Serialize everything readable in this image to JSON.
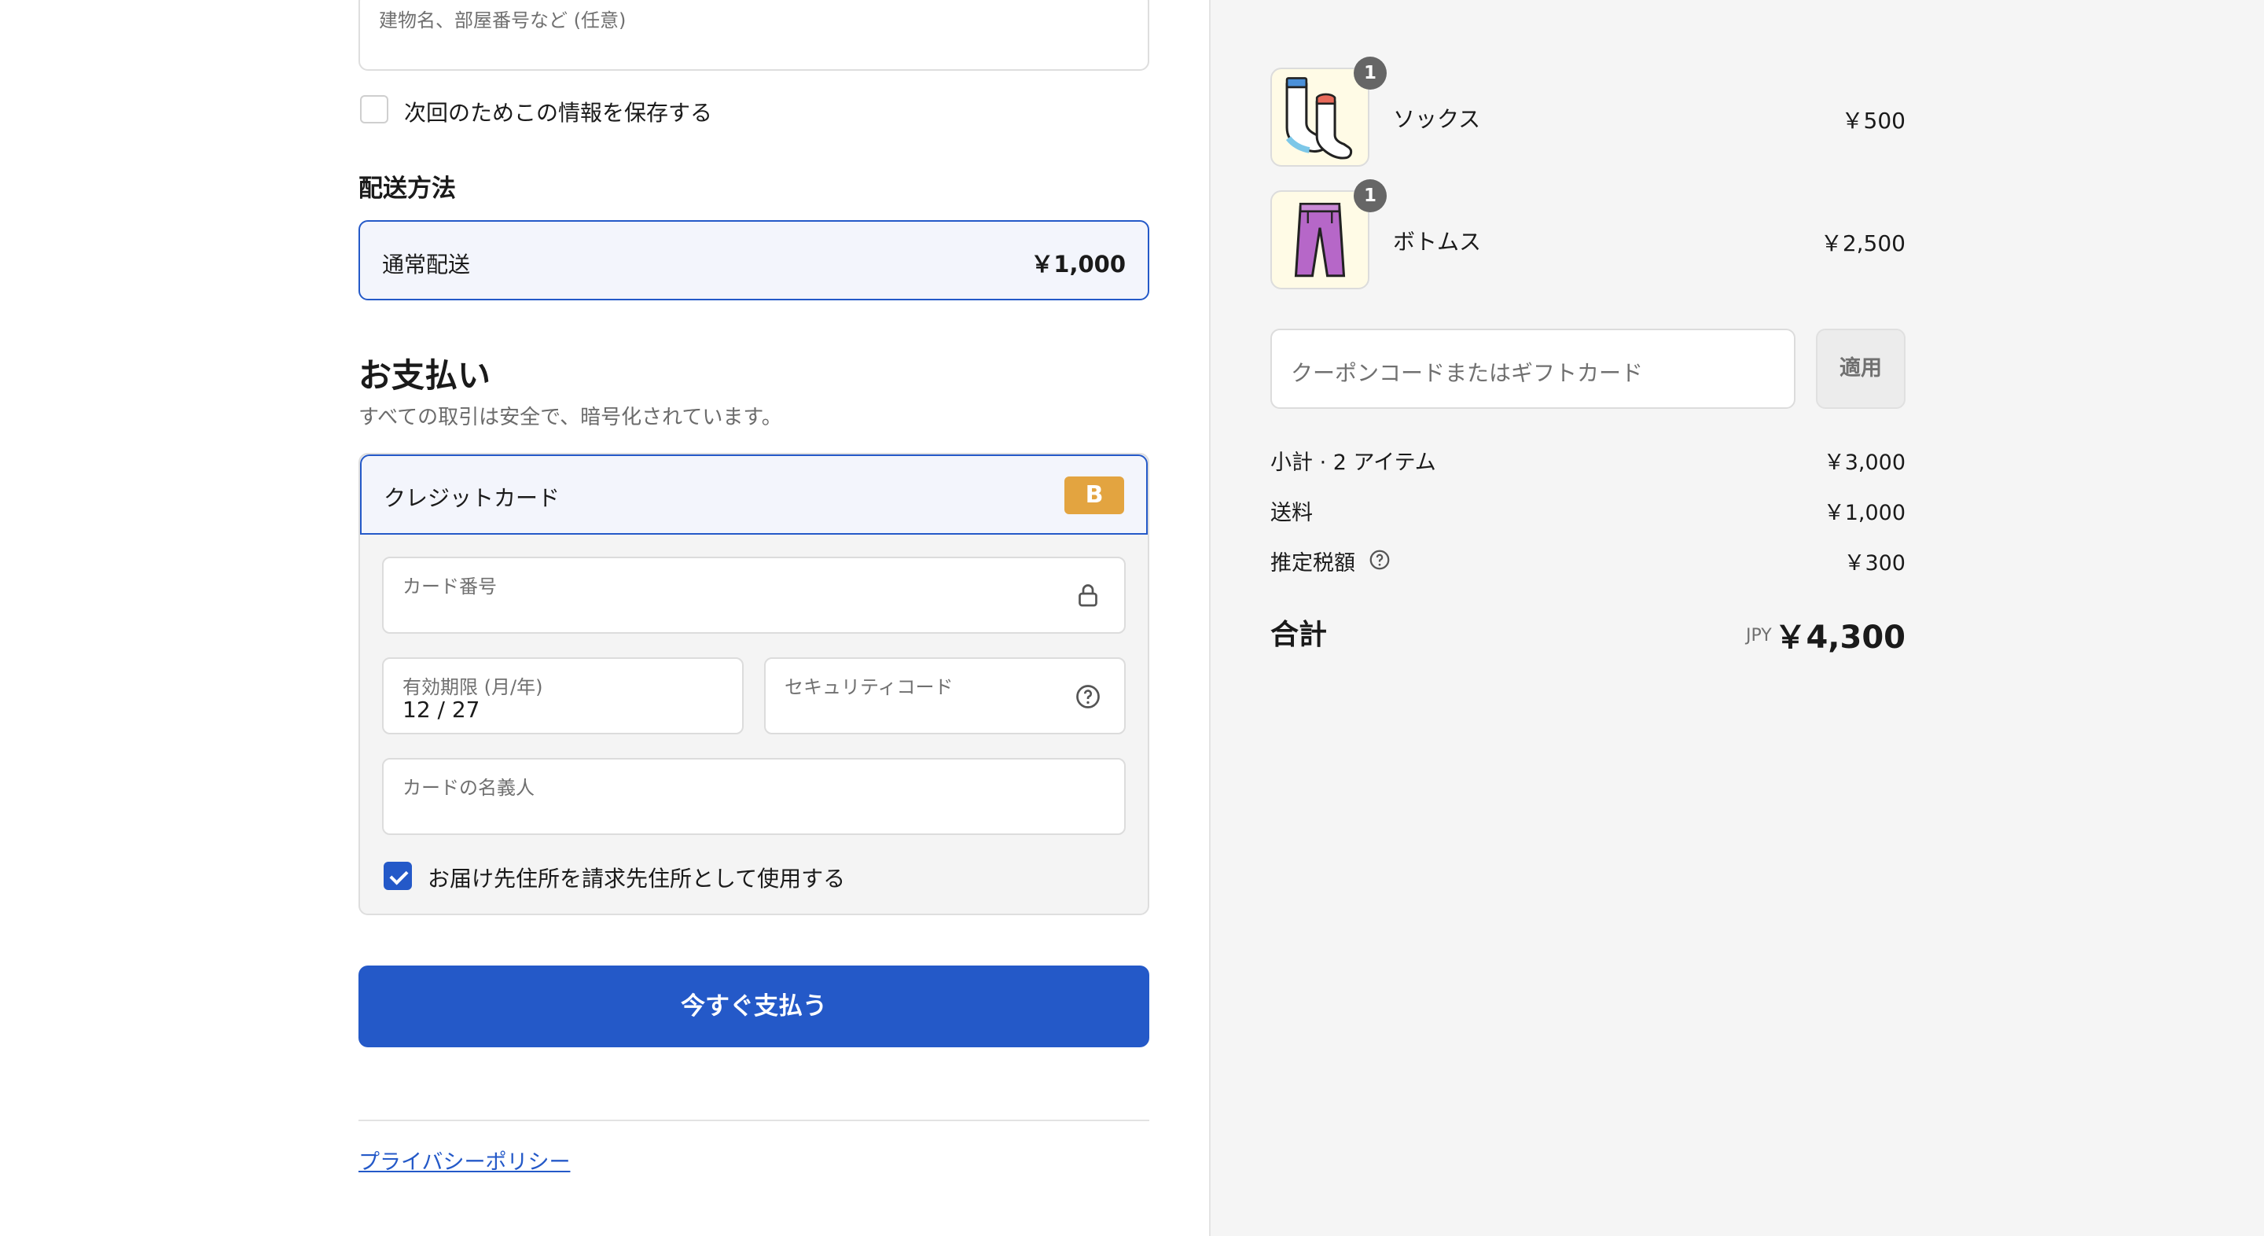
{
  "address": {
    "apartment_placeholder": "建物名、部屋番号など (任意)",
    "save_info_label": "次回のためこの情報を保存する"
  },
  "shipping": {
    "heading": "配送方法",
    "method_name": "通常配送",
    "method_price": "￥1,000"
  },
  "payment": {
    "heading": "お支払い",
    "subtext": "すべての取引は安全で、暗号化されています。",
    "method_name": "クレジットカード",
    "brand_badge": "B",
    "card_number_label": "カード番号",
    "expiry_label": "有効期限 (月/年)",
    "expiry_value": "12 / 27",
    "security_code_label": "セキュリティコード",
    "cardholder_label": "カードの名義人",
    "billing_same_label": "お届け先住所を請求先住所として使用する",
    "billing_same_checked": true,
    "pay_button": "今すぐ支払う"
  },
  "footer": {
    "privacy_link": "プライバシーポリシー"
  },
  "summary": {
    "items": [
      {
        "name": "ソックス",
        "price": "￥500",
        "qty": "1",
        "icon": "socks-icon"
      },
      {
        "name": "ボトムス",
        "price": "￥2,500",
        "qty": "1",
        "icon": "pants-icon"
      }
    ],
    "coupon_placeholder": "クーポンコードまたはギフトカード",
    "apply_button": "適用",
    "subtotal_label": "小計 · 2 アイテム",
    "subtotal_value": "￥3,000",
    "shipping_label": "送料",
    "shipping_value": "￥1,000",
    "tax_label": "推定税額",
    "tax_value": "￥300",
    "total_label": "合計",
    "total_currency": "JPY",
    "total_value": "￥4,300"
  },
  "colors": {
    "accent": "#2459c8",
    "badge": "#e3a440",
    "panel": "#f5f5f5"
  }
}
